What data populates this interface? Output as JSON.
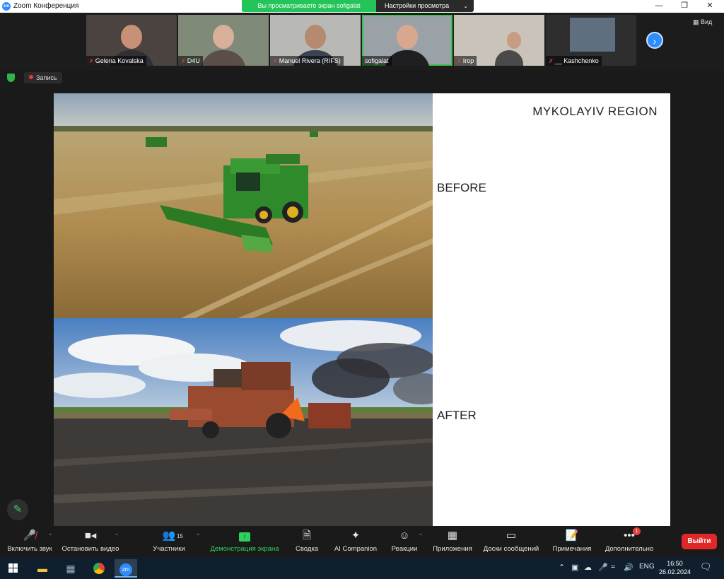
{
  "window": {
    "title": "Zoom Конференция",
    "app_icon": "zm",
    "controls": [
      "minimize-icon",
      "restore-icon",
      "close-icon"
    ]
  },
  "share_banner": {
    "text": "Вы просматриваете экран sofigalat",
    "view_settings": "Настройки просмотра"
  },
  "participants": [
    {
      "name": "Gelena Kovalska",
      "muted": true
    },
    {
      "name": "D4U",
      "muted": true
    },
    {
      "name": "Manuel Rivera (RIFS)",
      "muted": true
    },
    {
      "name": "sofigalat",
      "muted": false,
      "active_speaker": true
    },
    {
      "name": "Irop",
      "muted": true
    },
    {
      "name": "__ Kashchenko",
      "muted": true
    }
  ],
  "view_button": "Вид",
  "recording": {
    "label": "Запись"
  },
  "slide": {
    "region": "MYKOLAYIV REGION",
    "before_label": "BEFORE",
    "after_label": "AFTER"
  },
  "toolbar": {
    "unmute": "Включить звук",
    "stop_video": "Остановить видео",
    "participants": "Участники",
    "participants_count": "15",
    "share_screen": "Демонстрация экрана",
    "summary": "Сводка",
    "ai_companion": "AI Companion",
    "reactions": "Реакции",
    "apps": "Приложения",
    "whiteboards": "Доски сообщений",
    "notes": "Примечания",
    "more": "Дополнительно",
    "more_badge": "1",
    "leave": "Выйти"
  },
  "taskbar": {
    "language": "ENG",
    "time": "16:50",
    "date": "26.02.2024"
  },
  "colors": {
    "zoom_blue": "#2d8cff",
    "share_green": "#23c45a",
    "leave_red": "#e02828"
  }
}
